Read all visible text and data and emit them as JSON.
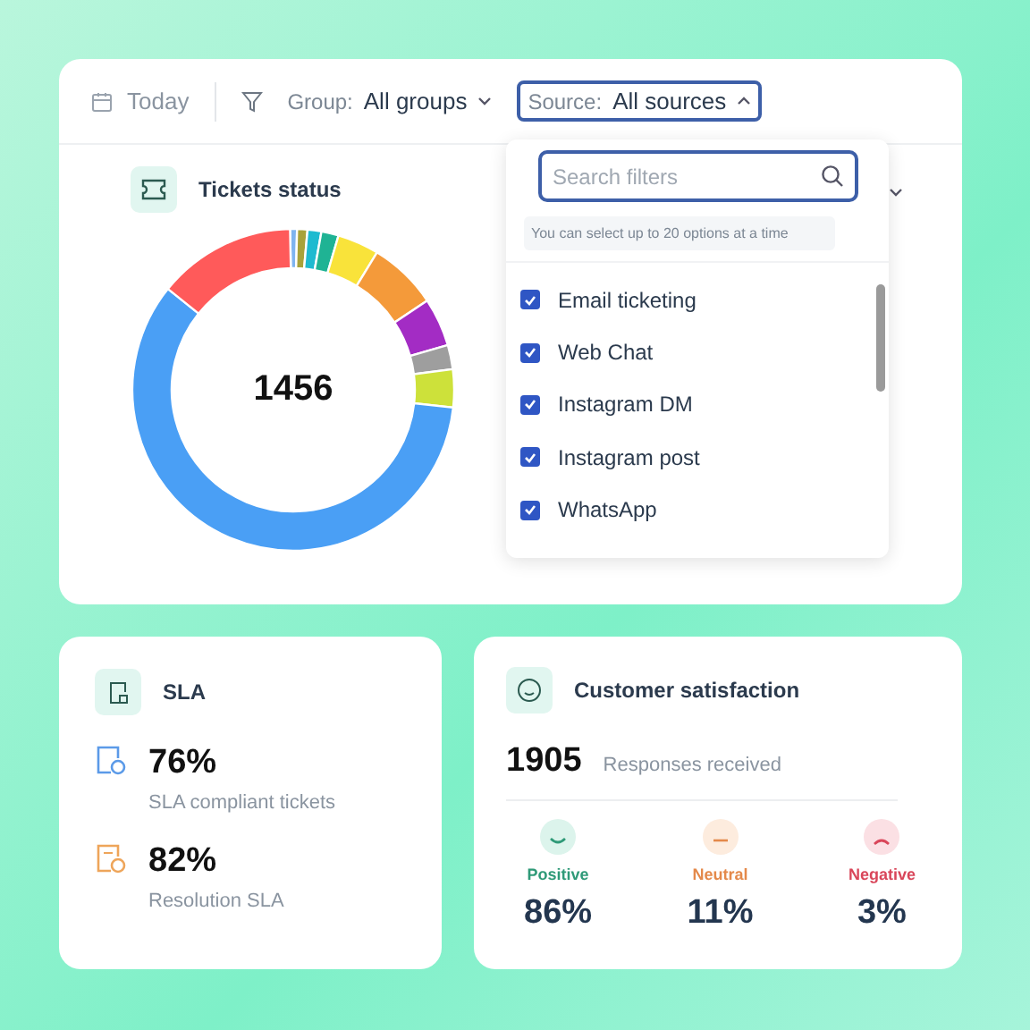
{
  "toolbar": {
    "date": "Today",
    "group": {
      "label": "Group:",
      "value": "All groups",
      "expanded": false
    },
    "source": {
      "label": "Source:",
      "value": "All sources",
      "expanded": true
    }
  },
  "source_dropdown": {
    "search": {
      "placeholder": "Search filters"
    },
    "hint": "You can select up to 20 options at a time",
    "options": [
      {
        "label": "Email ticketing",
        "checked": true
      },
      {
        "label": "Web Chat",
        "checked": true
      },
      {
        "label": "Instagram DM",
        "checked": true
      },
      {
        "label": "Instagram post",
        "checked": true
      },
      {
        "label": "WhatsApp",
        "checked": true
      }
    ]
  },
  "tickets_status": {
    "title": "Tickets status",
    "total": "1456"
  },
  "sla": {
    "title": "SLA",
    "metrics": [
      {
        "kind": "compliant",
        "value": "76%",
        "label": "SLA compliant tickets"
      },
      {
        "kind": "resolution",
        "value": "82%",
        "label": "Resolution SLA"
      }
    ]
  },
  "customer_satisfaction": {
    "title": "Customer satisfaction",
    "count": "1905",
    "count_label": "Responses received",
    "moods": [
      {
        "kind": "positive",
        "label": "Positive",
        "value": "86%"
      },
      {
        "kind": "neutral",
        "label": "Neutral",
        "value": "11%"
      },
      {
        "kind": "negative",
        "label": "Negative",
        "value": "3%"
      }
    ]
  }
}
